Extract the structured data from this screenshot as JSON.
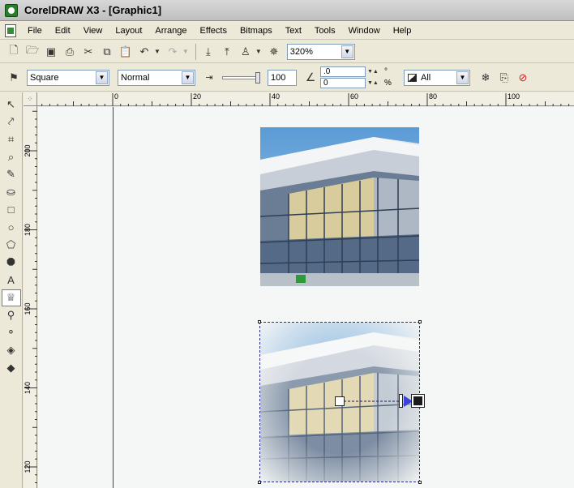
{
  "window": {
    "title": "CorelDRAW X3 - [Graphic1]"
  },
  "menu": {
    "items": [
      "File",
      "Edit",
      "View",
      "Layout",
      "Arrange",
      "Effects",
      "Bitmaps",
      "Text",
      "Tools",
      "Window",
      "Help"
    ]
  },
  "standard_toolbar": {
    "zoom_level": "320%"
  },
  "property_bar": {
    "shape_type": "Square",
    "merge_mode": "Normal",
    "feather_value": "100",
    "angle_value": ".0",
    "angle_unit": "°",
    "edge_pad_value": "0",
    "edge_pad_unit": "%",
    "target_value": "All"
  },
  "rulers": {
    "corner_symbol": "⁘",
    "horizontal_labels": [
      "0",
      "20",
      "40",
      "60",
      "80",
      "100"
    ],
    "vertical_labels": [
      "200",
      "180",
      "160",
      "140",
      "120"
    ]
  },
  "colors": {
    "toolbar_bg": "#ece9d8",
    "canvas_bg": "#f5f7f6",
    "selection_outline": "#2b2b8a",
    "transparency_arrow": "#3a44d6"
  }
}
